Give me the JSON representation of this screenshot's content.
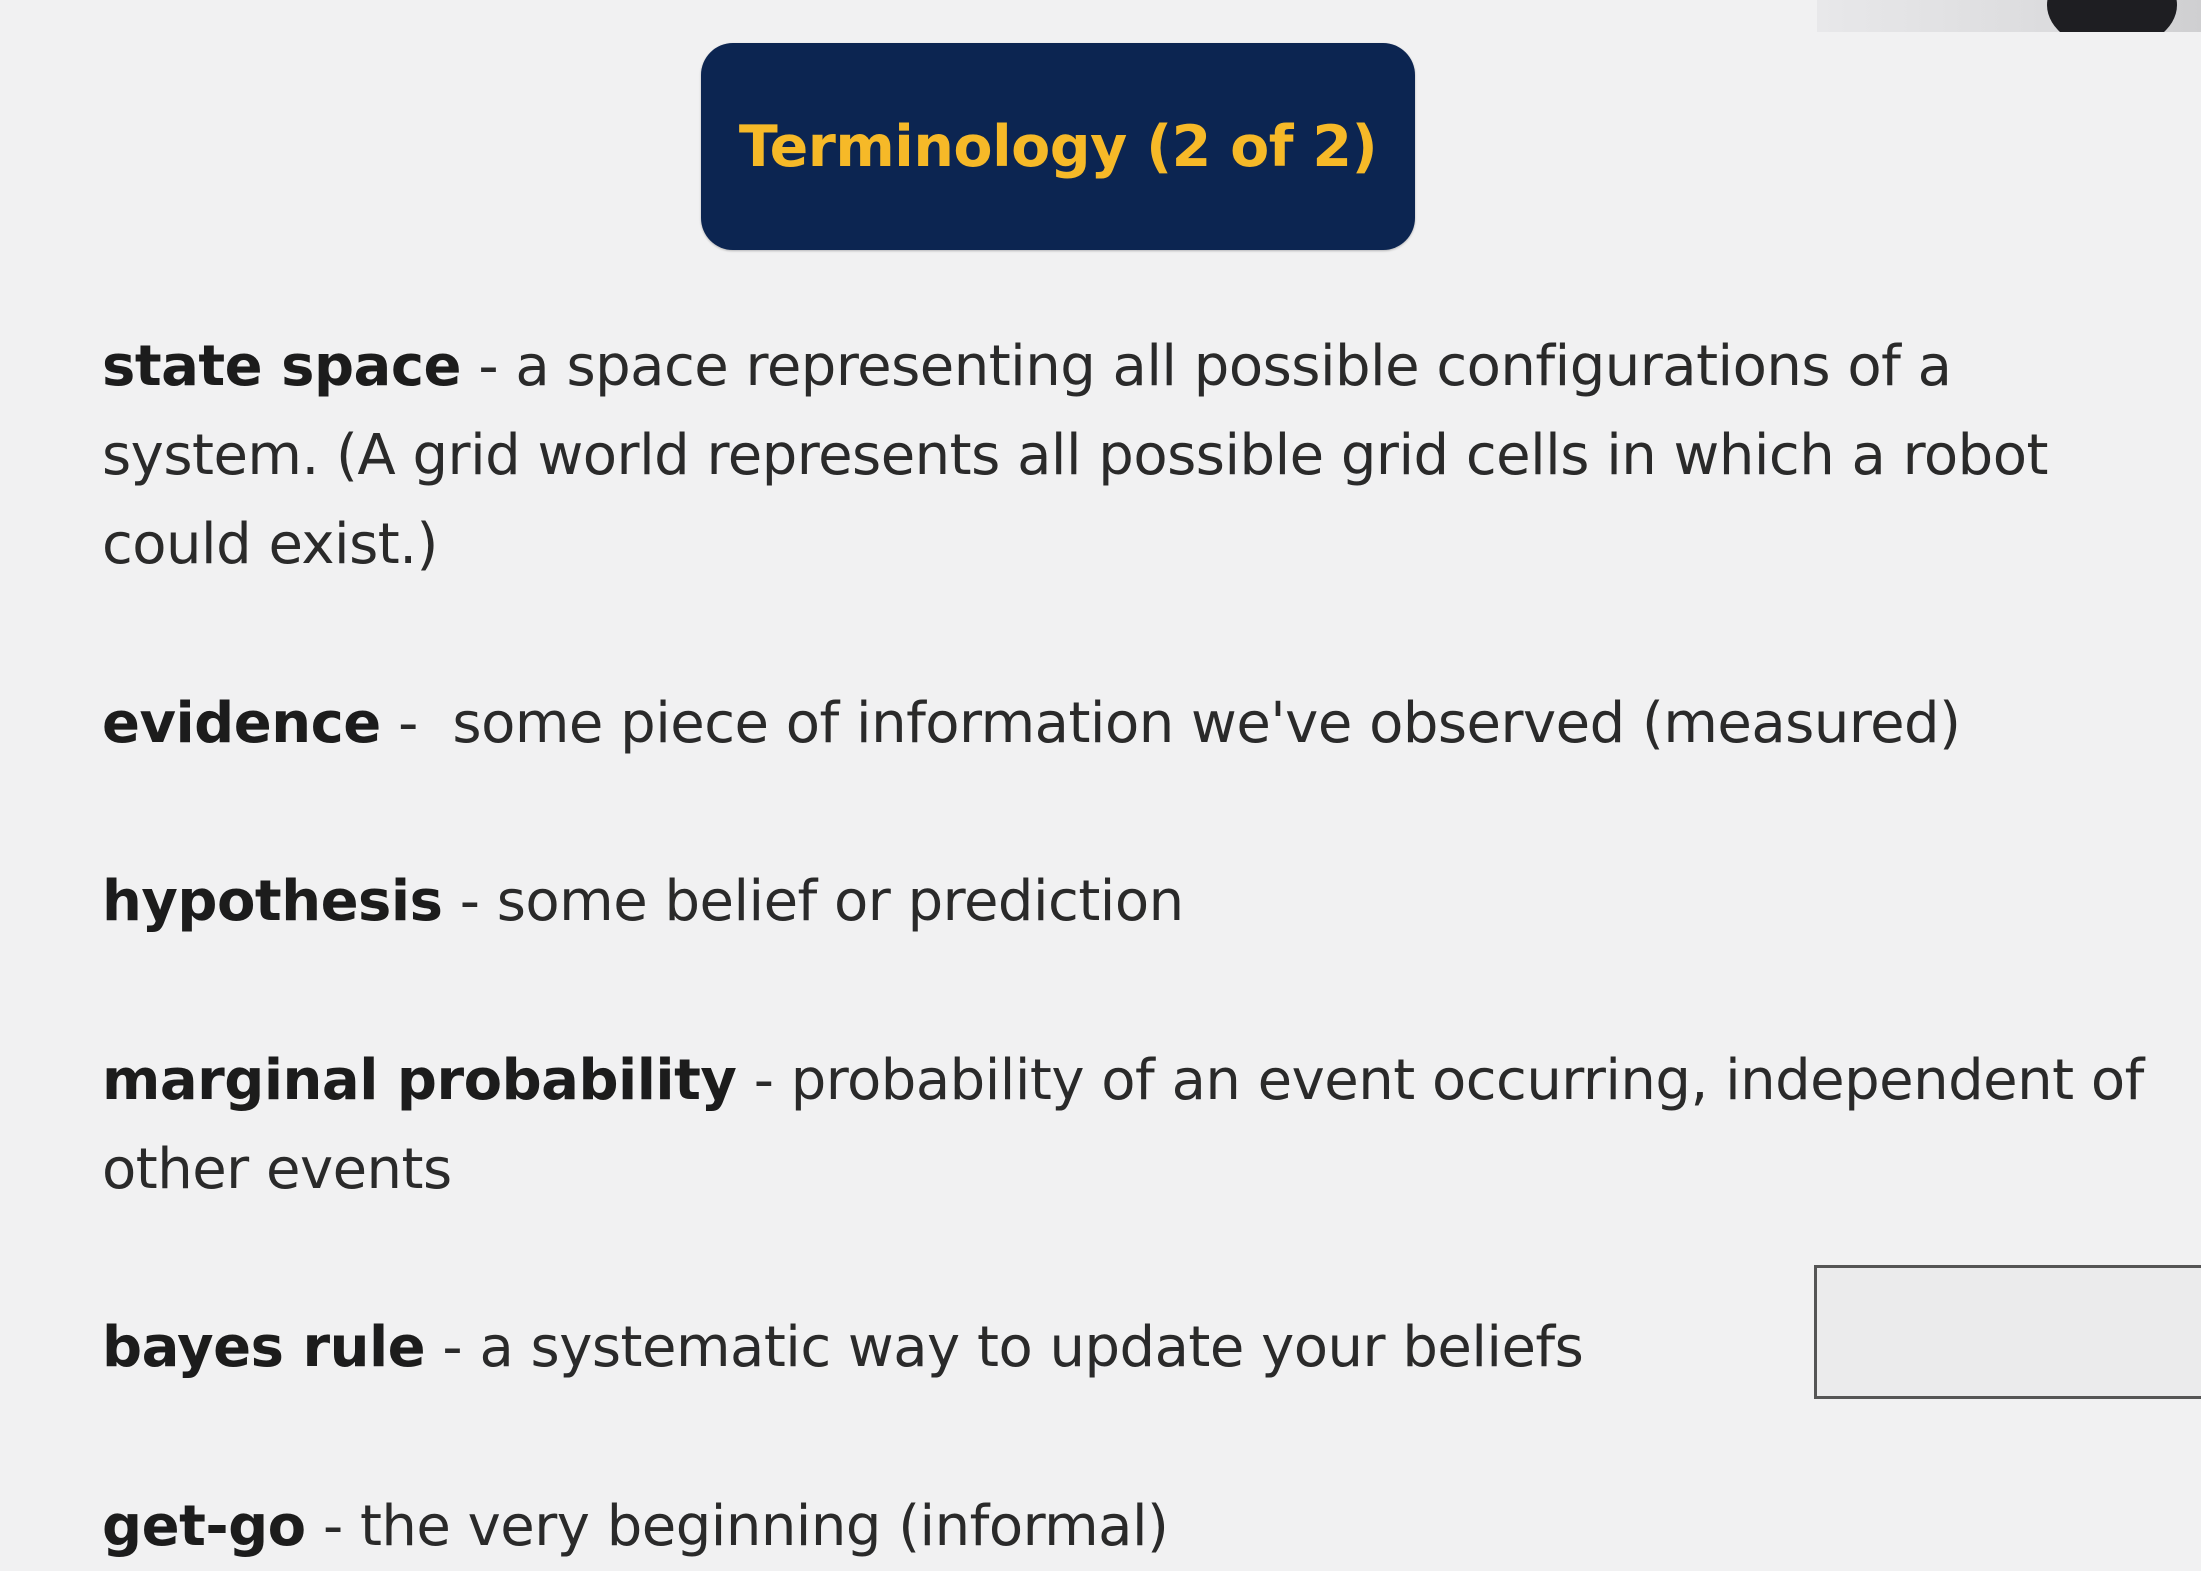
{
  "slide": {
    "title": "Terminology (2 of 2)",
    "terms": [
      {
        "name": "state space",
        "separator": " - ",
        "definition": "a space representing all possible configurations of a system.  (A grid world represents all possible grid cells in which a robot could exist.)"
      },
      {
        "name": "evidence",
        "separator": " -  ",
        "definition": "some piece of information we've observed (measured)"
      },
      {
        "name": "hypothesis",
        "separator": " - ",
        "definition": "some belief or prediction"
      },
      {
        "name": "marginal probability",
        "separator": " - ",
        "definition": "probability of an event occurring, independent of other events"
      },
      {
        "name": "bayes rule",
        "separator": " - ",
        "definition": "a systematic way to update your beliefs"
      },
      {
        "name": "get-go",
        "separator": " - ",
        "definition": "the very beginning (informal)"
      }
    ]
  }
}
